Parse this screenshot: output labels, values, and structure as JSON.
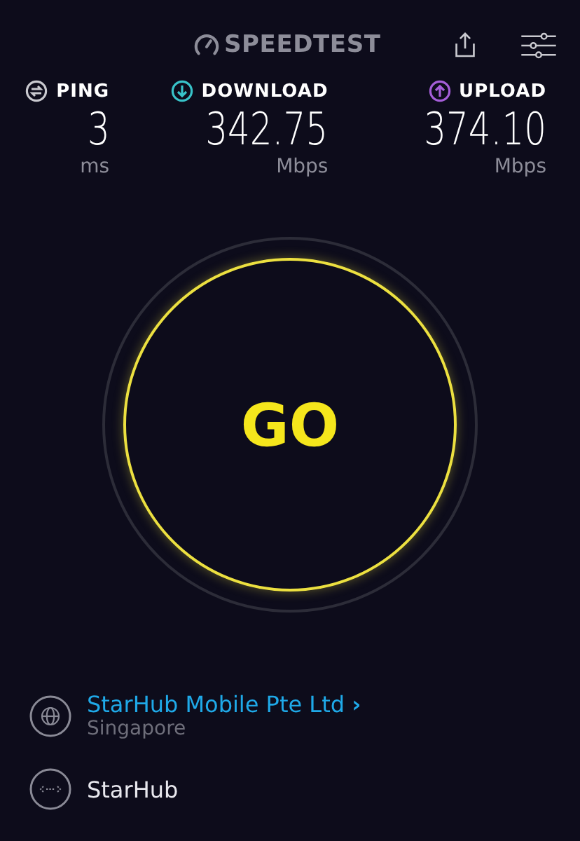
{
  "header": {
    "logo": "SPEEDTEST"
  },
  "metrics": [
    {
      "kind": "ping",
      "label": "PING",
      "value": "3",
      "unit": "ms",
      "color": "#c9c9cf"
    },
    {
      "kind": "download",
      "label": "DOWNLOAD",
      "value": "342.75",
      "unit": "Mbps",
      "color": "#38c3c9"
    },
    {
      "kind": "upload",
      "label": "UPLOAD",
      "value": "374.10",
      "unit": "Mbps",
      "color": "#a55ed8"
    }
  ],
  "go_button": {
    "label": "GO"
  },
  "provider": {
    "name": "StarHub Mobile Pte Ltd",
    "chevron": "›",
    "location": "Singapore"
  },
  "server": {
    "name": "StarHub"
  }
}
